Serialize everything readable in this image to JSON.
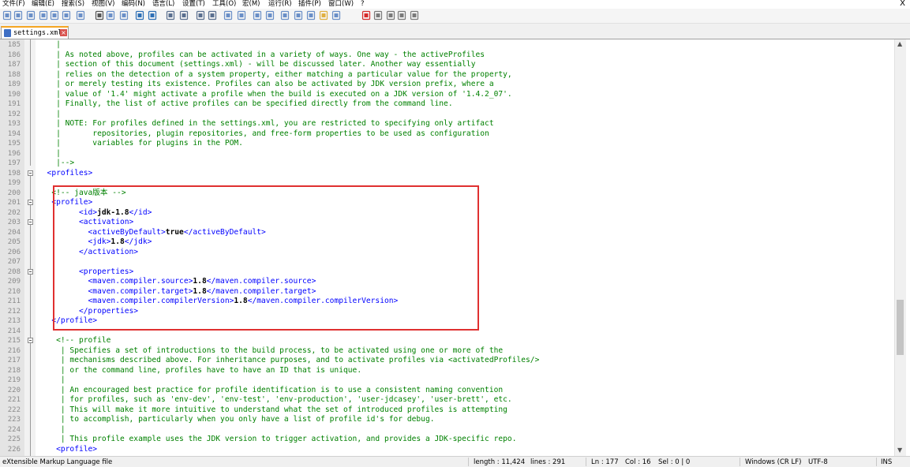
{
  "menu": {
    "items": [
      "文件(F)",
      "编辑(E)",
      "搜索(S)",
      "视图(V)",
      "编码(N)",
      "语言(L)",
      "设置(T)",
      "工具(O)",
      "宏(M)",
      "运行(R)",
      "插件(P)",
      "窗口(W)",
      "?"
    ],
    "close_label": "X"
  },
  "toolbar": {
    "icons": [
      "new-file-icon",
      "open-file-icon",
      "save-icon",
      "save-all-icon",
      "close-icon",
      "close-all-icon",
      "print-icon",
      "cut-icon",
      "copy-icon",
      "paste-icon",
      "undo-icon",
      "redo-icon",
      "find-icon",
      "replace-icon",
      "zoom-in-icon",
      "zoom-out-icon",
      "sync-vertical-icon",
      "sync-horizontal-icon",
      "word-wrap-icon",
      "show-all-chars-icon",
      "indent-guide-icon",
      "doc-map-icon",
      "function-list-icon",
      "folder-workspace-icon",
      "monitoring-icon",
      "record-macro-icon",
      "stop-macro-icon",
      "play-macro-icon",
      "run-macro-multiple-icon",
      "save-macro-icon"
    ],
    "accent": "#d62b2b"
  },
  "tab": {
    "label": "settings.xml"
  },
  "editor": {
    "lines": [
      {
        "n": "185",
        "tokens": [
          {
            "t": "c",
            "v": "    |"
          }
        ]
      },
      {
        "n": "186",
        "tokens": [
          {
            "t": "c",
            "v": "    | As noted above, profiles can be activated in a variety of ways. One way - the activeProfiles"
          }
        ]
      },
      {
        "n": "187",
        "tokens": [
          {
            "t": "c",
            "v": "    | section of this document (settings.xml) - will be discussed later. Another way essentially"
          }
        ]
      },
      {
        "n": "188",
        "tokens": [
          {
            "t": "c",
            "v": "    | relies on the detection of a system property, either matching a particular value for the property,"
          }
        ]
      },
      {
        "n": "189",
        "tokens": [
          {
            "t": "c",
            "v": "    | or merely testing its existence. Profiles can also be activated by JDK version prefix, where a"
          }
        ]
      },
      {
        "n": "190",
        "tokens": [
          {
            "t": "c",
            "v": "    | value of '1.4' might activate a profile when the build is executed on a JDK version of '1.4.2_07'."
          }
        ]
      },
      {
        "n": "191",
        "tokens": [
          {
            "t": "c",
            "v": "    | Finally, the list of active profiles can be specified directly from the command line."
          }
        ]
      },
      {
        "n": "192",
        "tokens": [
          {
            "t": "c",
            "v": "    |"
          }
        ]
      },
      {
        "n": "193",
        "tokens": [
          {
            "t": "c",
            "v": "    | NOTE: For profiles defined in the settings.xml, you are restricted to specifying only artifact"
          }
        ]
      },
      {
        "n": "194",
        "tokens": [
          {
            "t": "c",
            "v": "    |       repositories, plugin repositories, and free-form properties to be used as configuration"
          }
        ]
      },
      {
        "n": "195",
        "tokens": [
          {
            "t": "c",
            "v": "    |       variables for plugins in the POM."
          }
        ]
      },
      {
        "n": "196",
        "tokens": [
          {
            "t": "c",
            "v": "    |"
          }
        ]
      },
      {
        "n": "197",
        "tokens": [
          {
            "t": "c",
            "v": "    |-->"
          }
        ]
      },
      {
        "n": "198",
        "fold": true,
        "tokens": [
          {
            "t": "g",
            "v": "  <profiles>"
          }
        ]
      },
      {
        "n": "199",
        "tokens": []
      },
      {
        "n": "200",
        "tokens": [
          {
            "t": "c",
            "v": "   <!-- java版本 -->"
          }
        ]
      },
      {
        "n": "201",
        "fold": true,
        "tokens": [
          {
            "t": "g",
            "v": "   <profile>"
          }
        ]
      },
      {
        "n": "202",
        "tokens": [
          {
            "t": "g",
            "v": "         <id>"
          },
          {
            "t": "x",
            "v": "jdk-1.8"
          },
          {
            "t": "g",
            "v": "</id>"
          }
        ]
      },
      {
        "n": "203",
        "fold": true,
        "tokens": [
          {
            "t": "g",
            "v": "         <activation>"
          }
        ]
      },
      {
        "n": "204",
        "tokens": [
          {
            "t": "g",
            "v": "           <activeByDefault>"
          },
          {
            "t": "x",
            "v": "true"
          },
          {
            "t": "g",
            "v": "</activeByDefault>"
          }
        ]
      },
      {
        "n": "205",
        "tokens": [
          {
            "t": "g",
            "v": "           <jdk>"
          },
          {
            "t": "x",
            "v": "1.8"
          },
          {
            "t": "g",
            "v": "</jdk>"
          }
        ]
      },
      {
        "n": "206",
        "tokens": [
          {
            "t": "g",
            "v": "         </activation>"
          }
        ]
      },
      {
        "n": "207",
        "tokens": []
      },
      {
        "n": "208",
        "fold": true,
        "tokens": [
          {
            "t": "g",
            "v": "         <properties>"
          }
        ]
      },
      {
        "n": "209",
        "tokens": [
          {
            "t": "g",
            "v": "           <maven.compiler.source>"
          },
          {
            "t": "x",
            "v": "1.8"
          },
          {
            "t": "g",
            "v": "</maven.compiler.source>"
          }
        ]
      },
      {
        "n": "210",
        "tokens": [
          {
            "t": "g",
            "v": "           <maven.compiler.target>"
          },
          {
            "t": "x",
            "v": "1.8"
          },
          {
            "t": "g",
            "v": "</maven.compiler.target>"
          }
        ]
      },
      {
        "n": "211",
        "tokens": [
          {
            "t": "g",
            "v": "           <maven.compiler.compilerVersion>"
          },
          {
            "t": "x",
            "v": "1.8"
          },
          {
            "t": "g",
            "v": "</maven.compiler.compilerVersion>"
          }
        ]
      },
      {
        "n": "212",
        "tokens": [
          {
            "t": "g",
            "v": "         </properties>"
          }
        ]
      },
      {
        "n": "213",
        "tokens": [
          {
            "t": "g",
            "v": "   </profile>"
          }
        ]
      },
      {
        "n": "214",
        "tokens": []
      },
      {
        "n": "215",
        "fold": true,
        "tokens": [
          {
            "t": "c",
            "v": "    <!-- profile"
          }
        ]
      },
      {
        "n": "216",
        "tokens": [
          {
            "t": "c",
            "v": "     | Specifies a set of introductions to the build process, to be activated using one or more of the"
          }
        ]
      },
      {
        "n": "217",
        "tokens": [
          {
            "t": "c",
            "v": "     | mechanisms described above. For inheritance purposes, and to activate profiles via <activatedProfiles/>"
          }
        ]
      },
      {
        "n": "218",
        "tokens": [
          {
            "t": "c",
            "v": "     | or the command line, profiles have to have an ID that is unique."
          }
        ]
      },
      {
        "n": "219",
        "tokens": [
          {
            "t": "c",
            "v": "     |"
          }
        ]
      },
      {
        "n": "220",
        "tokens": [
          {
            "t": "c",
            "v": "     | An encouraged best practice for profile identification is to use a consistent naming convention"
          }
        ]
      },
      {
        "n": "221",
        "tokens": [
          {
            "t": "c",
            "v": "     | for profiles, such as 'env-dev', 'env-test', 'env-production', 'user-jdcasey', 'user-brett', etc."
          }
        ]
      },
      {
        "n": "222",
        "tokens": [
          {
            "t": "c",
            "v": "     | This will make it more intuitive to understand what the set of introduced profiles is attempting"
          }
        ]
      },
      {
        "n": "223",
        "tokens": [
          {
            "t": "c",
            "v": "     | to accomplish, particularly when you only have a list of profile id's for debug."
          }
        ]
      },
      {
        "n": "224",
        "tokens": [
          {
            "t": "c",
            "v": "     |"
          }
        ]
      },
      {
        "n": "225",
        "tokens": [
          {
            "t": "c",
            "v": "     | This profile example uses the JDK version to trigger activation, and provides a JDK-specific repo."
          }
        ]
      },
      {
        "n": "226",
        "tokens": [
          {
            "t": "g",
            "v": "    <profile>"
          }
        ]
      }
    ],
    "colors": {
      "comment": "#008000",
      "tag": "#0000ff",
      "text": "#000000",
      "highlight_box": "#e03030"
    }
  },
  "status": {
    "file_type": "eXtensible Markup Language file",
    "length": "length : 11,424",
    "lines": "lines : 291",
    "cursor": "Ln : 177",
    "col": "Col : 16",
    "sel": "Sel : 0 | 0",
    "eol": "Windows (CR LF)",
    "encoding": "UTF-8",
    "mode": "INS"
  }
}
